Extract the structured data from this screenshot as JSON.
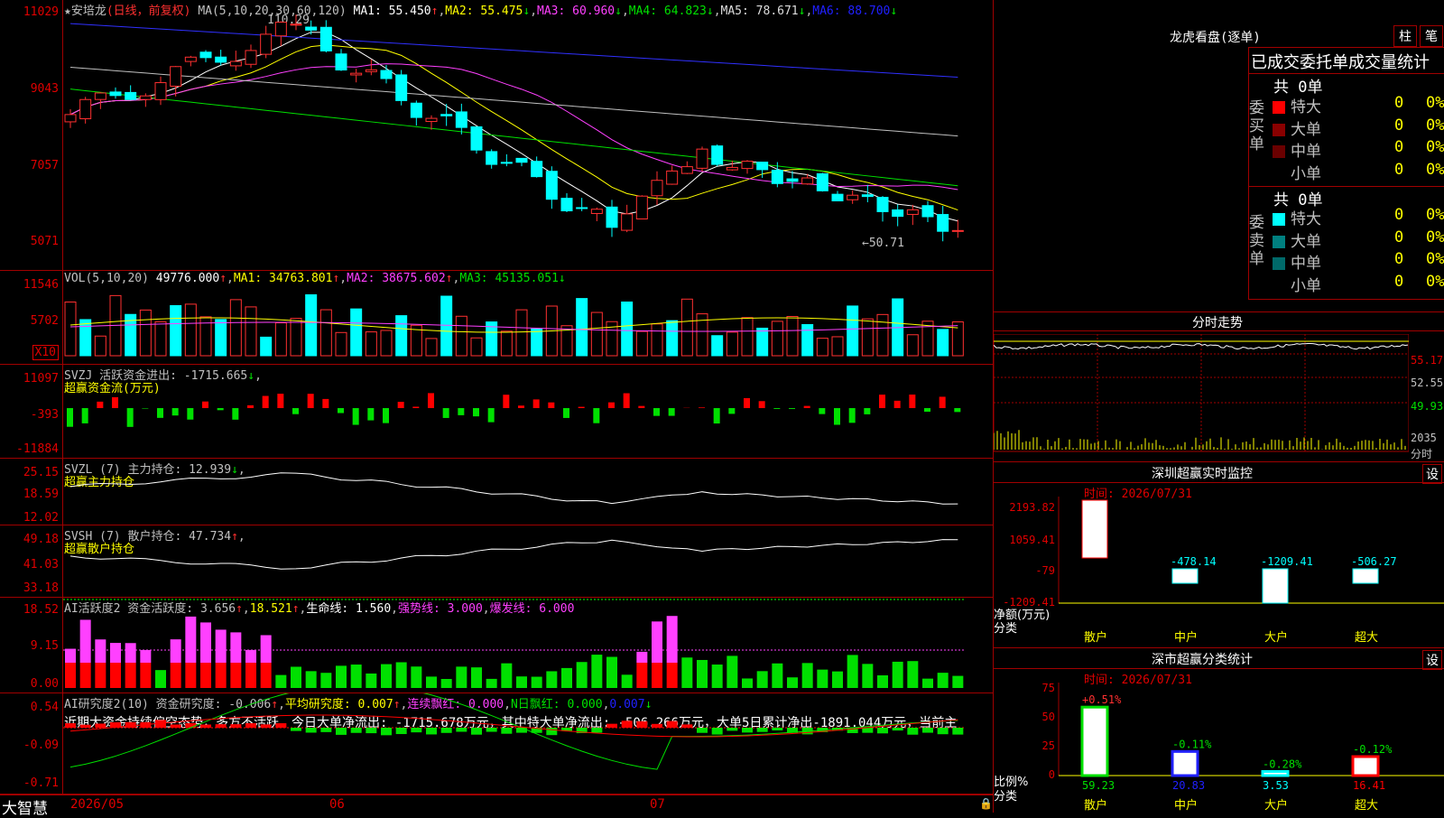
{
  "stock": {
    "name": "安培龙",
    "period": "(日线，前复权)"
  },
  "main": {
    "y_labels": [
      "11029",
      "9043",
      "7057",
      "5071"
    ],
    "ma_header": "MA(5,10,20,30,60,120)",
    "ma1": "MA1: 55.450",
    "ma2": "MA2: 55.475",
    "ma3": "MA3: 60.960",
    "ma4": "MA4: 64.823",
    "ma5": "MA5: 78.671",
    "ma6": "MA6: 88.700",
    "high_label": "110.29",
    "low_label": "←50.71"
  },
  "vol": {
    "y_labels": [
      "11546",
      "5702"
    ],
    "unit": "X10",
    "header": "VOL(5,10,20)",
    "v": "49776.000",
    "ma1": "MA1: 34763.801",
    "ma2": "MA2: 38675.602",
    "ma3": "MA3: 45135.051"
  },
  "svzj": {
    "y_labels": [
      "11097",
      "-393",
      "-11884"
    ],
    "header": "SVZJ  活跃资金进出: -1715.665",
    "sub": "超赢资金流(万元)"
  },
  "svzl": {
    "y_labels": [
      "25.15",
      "18.59",
      "12.02"
    ],
    "header": "SVZL (7) 主力持仓: 12.939",
    "sub": "超赢主力持仓"
  },
  "svsh": {
    "y_labels": [
      "49.18",
      "41.03",
      "33.18"
    ],
    "header": "SVSH (7) 散户持仓: 47.734",
    "sub": "超赢散户持仓"
  },
  "ai1": {
    "y_labels": [
      "18.52",
      "9.15",
      "0.00"
    ],
    "h1": "AI活跃度2 资金活跃度: 3.656",
    "h2": "18.521",
    "h3": "生命线: 1.560",
    "h4": "强势线: 3.000",
    "h5": "爆发线: 6.000"
  },
  "ai2": {
    "y_labels": [
      "0.54",
      "-0.09",
      "-0.71"
    ],
    "h1": "AI研究度2(10) 资金研究度: -0.006",
    "h2": "平均研究度: 0.007",
    "h3": "连续飘红: 0.000",
    "h4": "N日飘红: 0.000",
    "h5": "0.007",
    "text": "近期大资金持续偏空态势，多方不活跃，今日大单净流出: -1715.678万元，其中特大单净流出: -506.266万元，大单5日累计净出-1891.044万元，当前主"
  },
  "xaxis": {
    "labels": [
      "2026/05",
      "06",
      "07"
    ]
  },
  "brand": "大智慧",
  "lhb": {
    "title": "龙虎看盘(逐单)",
    "btn1": "柱",
    "btn2": "笔",
    "tabs": "已成交委托单成交量统计",
    "buy_side": "委买单",
    "sell_side": "委卖单",
    "buy_total": "共 0单",
    "sell_total": "共 0单",
    "rows": [
      {
        "label": "特大",
        "n": "0",
        "p": "0%"
      },
      {
        "label": "大单",
        "n": "0",
        "p": "0%"
      },
      {
        "label": "中单",
        "n": "0",
        "p": "0%"
      },
      {
        "label": "小单",
        "n": "0",
        "p": "0%"
      }
    ]
  },
  "intraday": {
    "title": "分时走势",
    "labels": [
      "55.17",
      "52.55",
      "49.93",
      "2035",
      "分时"
    ]
  },
  "monitor": {
    "title": "深圳超赢实时监控",
    "btn": "设",
    "time": "时间: 2026/07/31",
    "y_labels": [
      "2193.82",
      "1059.41",
      "-79",
      "-1209.41"
    ],
    "axis1": "净额(万元)",
    "axis2": "分类",
    "cats": [
      "散户",
      "中户",
      "大户",
      "超大"
    ],
    "values": [
      "2193.82",
      "-478.14",
      "-1209.41",
      "-506.27"
    ]
  },
  "stat": {
    "title": "深市超赢分类统计",
    "btn": "设",
    "time": "时间: 2026/07/31",
    "y_labels": [
      "75",
      "50",
      "25",
      "0"
    ],
    "axis1": "比例%",
    "axis2": "分类",
    "cats": [
      "散户",
      "中户",
      "大户",
      "超大"
    ],
    "pcts": [
      "+0.51%",
      "-0.11%",
      "-0.28%",
      "-0.12%"
    ],
    "vals": [
      "59.23",
      "20.83",
      "3.53",
      "16.41"
    ]
  }
}
